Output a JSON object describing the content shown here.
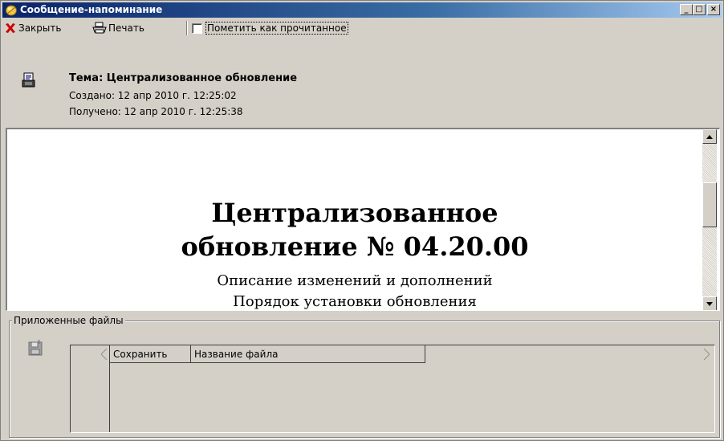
{
  "window": {
    "title": "Сообщение-напоминание",
    "controls": {
      "minimize": "_",
      "maximize": "□",
      "close": "×"
    }
  },
  "toolbar": {
    "close_label": "Закрыть",
    "print_label": "Печать",
    "mark_read_label": "Пометить как прочитанное",
    "mark_read_checked": false
  },
  "message": {
    "subject": "Тема: Централизованное обновление",
    "created": "Создано: 12 апр 2010 г. 12:25:02",
    "received": "Получено: 12 апр 2010 г. 12:25:38"
  },
  "document": {
    "heading_line1": "Централизованное",
    "heading_line2": "обновление № 04.20.00",
    "line1": "Описание изменений и дополнений",
    "line2": "Порядок установки обновления"
  },
  "attachments": {
    "group_label": "Приложенные файлы",
    "columns": [
      "Сохранить",
      "Название файла"
    ],
    "rows": []
  },
  "colors": {
    "titlebar_start": "#0a246a",
    "titlebar_end": "#a6caf0",
    "face": "#d4d0c8",
    "close_icon": "#cc0000"
  }
}
